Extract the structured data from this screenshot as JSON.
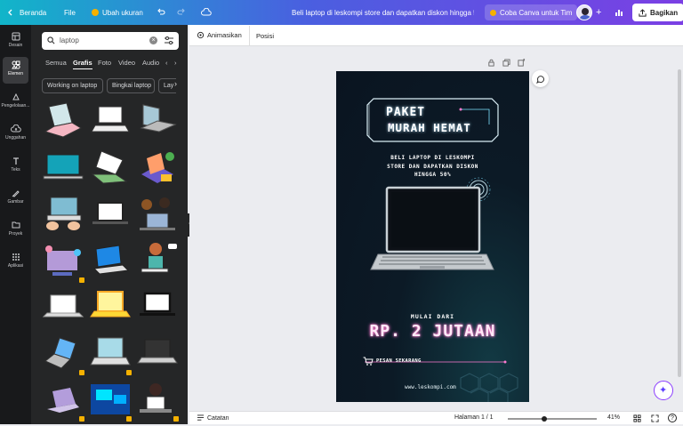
{
  "topbar": {
    "home_label": "Beranda",
    "file_label": "File",
    "resize_label": "Ubah ukuran",
    "doc_title": "Beli laptop di leskompi store dan dapatkan diskon hingga 5...",
    "try_label": "Coba Canva untuk Tim",
    "share_label": "Bagikan"
  },
  "rail": {
    "items": [
      {
        "label": "Desain",
        "icon": "layout-icon"
      },
      {
        "label": "Elemen",
        "icon": "shapes-icon"
      },
      {
        "label": "Pengelolaan...",
        "icon": "brand-icon"
      },
      {
        "label": "Unggahan",
        "icon": "cloud-upload-icon"
      },
      {
        "label": "Teks",
        "icon": "text-icon"
      },
      {
        "label": "Gambar",
        "icon": "draw-icon"
      },
      {
        "label": "Proyek",
        "icon": "folder-icon"
      },
      {
        "label": "Aplikasi",
        "icon": "apps-icon"
      }
    ]
  },
  "panel": {
    "search_value": "laptop",
    "tabs": [
      "Semua",
      "Grafis",
      "Foto",
      "Video",
      "Audio"
    ],
    "active_tab": "Grafis",
    "chips": [
      "Working on laptop",
      "Bingkai laptop",
      "Lay"
    ]
  },
  "editor": {
    "animate_label": "Animasikan",
    "position_label": "Posisi"
  },
  "design": {
    "title_line1": "PAKET",
    "title_line2": "MURAH HEMAT",
    "desc_line1": "BELI LAPTOP DI LESKOMPI",
    "desc_line2": "STORE DAN DAPATKAN DISKON",
    "desc_line3": "HINGGA 50%",
    "from_label": "MULAI DARI",
    "price": "RP. 2 JUTAAN",
    "order_label": "PESAN SEKARANG",
    "website": "www.leskompi.com"
  },
  "bottombar": {
    "notes_label": "Catatan",
    "page_label": "Halaman 1 / 1",
    "zoom": "41%",
    "zoom_level": 0.41
  },
  "colors": {
    "accent_pink": "#ff7bd0",
    "cyan": "#7de3ff",
    "brand_purple": "#8b3dff"
  }
}
